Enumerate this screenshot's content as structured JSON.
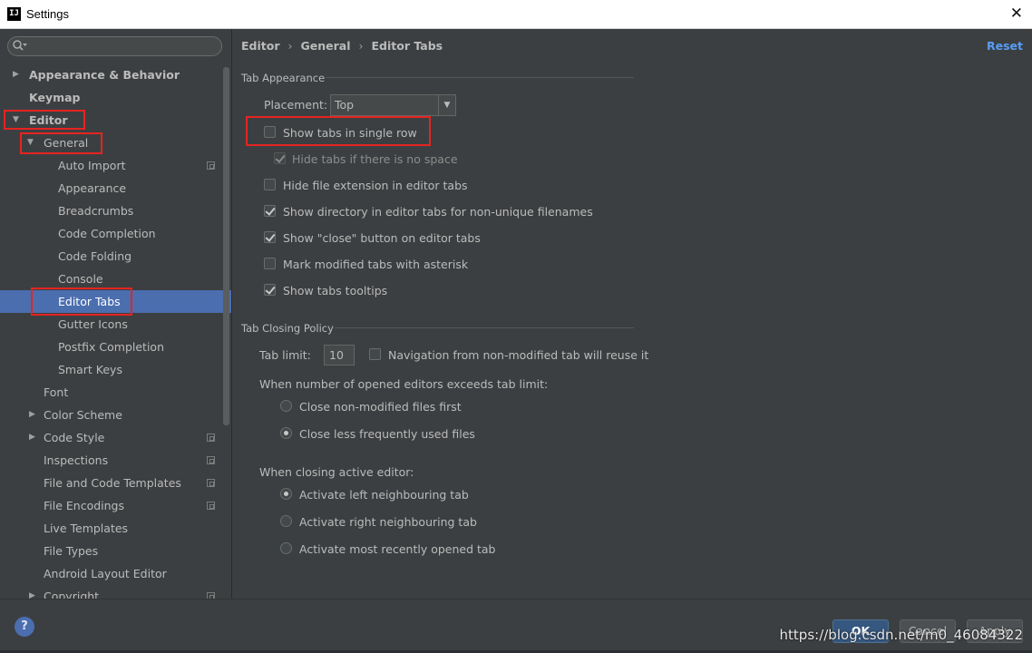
{
  "window": {
    "title": "Settings",
    "app_icon_text": "IJ"
  },
  "search": {
    "value": "",
    "placeholder": ""
  },
  "sidebar": {
    "items": [
      {
        "label": "Appearance & Behavior",
        "arrow": "▶"
      },
      {
        "label": "Keymap"
      },
      {
        "label": "Editor",
        "arrow": "▼"
      },
      {
        "label": "General",
        "arrow": "▼"
      },
      {
        "label": "Auto Import"
      },
      {
        "label": "Appearance"
      },
      {
        "label": "Breadcrumbs"
      },
      {
        "label": "Code Completion"
      },
      {
        "label": "Code Folding"
      },
      {
        "label": "Console"
      },
      {
        "label": "Editor Tabs"
      },
      {
        "label": "Gutter Icons"
      },
      {
        "label": "Postfix Completion"
      },
      {
        "label": "Smart Keys"
      },
      {
        "label": "Font"
      },
      {
        "label": "Color Scheme",
        "arrow": "▶"
      },
      {
        "label": "Code Style",
        "arrow": "▶"
      },
      {
        "label": "Inspections"
      },
      {
        "label": "File and Code Templates"
      },
      {
        "label": "File Encodings"
      },
      {
        "label": "Live Templates"
      },
      {
        "label": "File Types"
      },
      {
        "label": "Android Layout Editor"
      },
      {
        "label": "Copyright",
        "arrow": "▶"
      }
    ]
  },
  "breadcrumb": [
    "Editor",
    "General",
    "Editor Tabs"
  ],
  "breadcrumb_sep": "›",
  "reset_label": "Reset",
  "tab_appearance": {
    "title": "Tab Appearance",
    "placement_label": "Placement:",
    "placement_value": "Top",
    "dropdown_arrow": "▼",
    "options": [
      {
        "label": "Show tabs in single row",
        "checked": false
      },
      {
        "label": "Hide tabs if there is no space",
        "checked": true,
        "disabled": true
      },
      {
        "label": "Hide file extension in editor tabs",
        "checked": false
      },
      {
        "label": "Show directory in editor tabs for non-unique filenames",
        "checked": true
      },
      {
        "label": "Show \"close\" button on editor tabs",
        "checked": true
      },
      {
        "label": "Mark modified tabs with asterisk",
        "checked": false
      },
      {
        "label": "Show tabs tooltips",
        "checked": true
      }
    ]
  },
  "tab_closing": {
    "title": "Tab Closing Policy",
    "tab_limit_label": "Tab limit:",
    "tab_limit_value": "10",
    "navigation_label": "Navigation from non-modified tab will reuse it",
    "navigation_checked": false,
    "exceeds_label": "When number of opened editors exceeds tab limit:",
    "exceeds_options": [
      {
        "label": "Close non-modified files first",
        "checked": false
      },
      {
        "label": "Close less frequently used files",
        "checked": true
      }
    ],
    "closing_label": "When closing active editor:",
    "closing_options": [
      {
        "label": "Activate left neighbouring tab",
        "checked": true
      },
      {
        "label": "Activate right neighbouring tab",
        "checked": false
      },
      {
        "label": "Activate most recently opened tab",
        "checked": false
      }
    ]
  },
  "footer": {
    "help_label": "?",
    "ok_label": "OK",
    "cancel_label": "Cancel",
    "apply_label": "Apply",
    "watermark": "https://blog.csdn.net/m0_46084322"
  },
  "colors": {
    "accent": "#4b6eaf",
    "link": "#589df6",
    "highlight_box": "#e52421",
    "background": "#3c3f41"
  }
}
